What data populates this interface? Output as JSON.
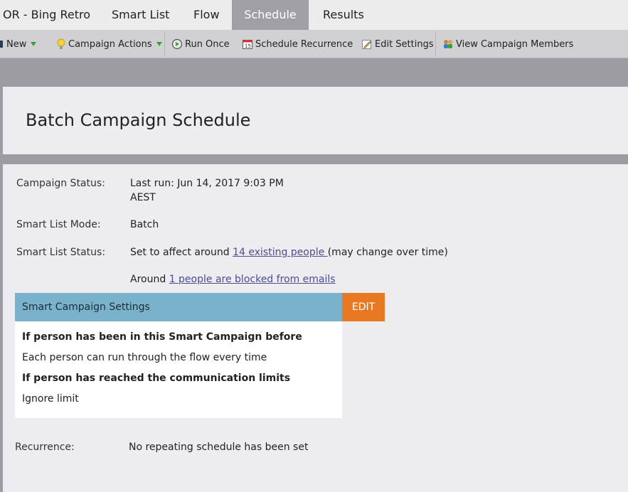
{
  "tabs": [
    {
      "label": "OR - Bing Retro",
      "active": false
    },
    {
      "label": "Smart List",
      "active": false
    },
    {
      "label": "Flow",
      "active": false
    },
    {
      "label": "Schedule",
      "active": true
    },
    {
      "label": "Results",
      "active": false
    }
  ],
  "toolbar": {
    "new_label": "New",
    "campaign_actions_label": "Campaign Actions",
    "run_once_label": "Run Once",
    "schedule_recurrence_label": "Schedule Recurrence",
    "edit_settings_label": "Edit Settings",
    "view_members_label": "View Campaign Members"
  },
  "page_title": "Batch Campaign Schedule",
  "status": {
    "campaign_status_label": "Campaign Status:",
    "last_run_line1": "Last run: Jun 14, 2017 9:03 PM",
    "last_run_line2": "AEST",
    "smart_list_mode_label": "Smart List Mode:",
    "smart_list_mode_value": "Batch",
    "smart_list_status_label": "Smart List Status:",
    "affect_prefix": "Set to affect around ",
    "affect_link": "14 existing people ",
    "affect_suffix": "(may change over time)",
    "blocked_prefix": "Around ",
    "blocked_link": "1 people are blocked from emails"
  },
  "settings": {
    "header": "Smart Campaign Settings",
    "edit_label": "EDIT",
    "q1": "If person has been in this Smart Campaign before",
    "a1": "Each person can run through the flow every time",
    "q2": "If person has reached the communication limits",
    "a2": "Ignore limit"
  },
  "recurrence": {
    "label": "Recurrence:",
    "value": "No repeating schedule has been set"
  },
  "colors": {
    "accent_blue": "#7ab2cc",
    "edit_orange": "#e87821",
    "active_tab": "#a19fa6"
  }
}
